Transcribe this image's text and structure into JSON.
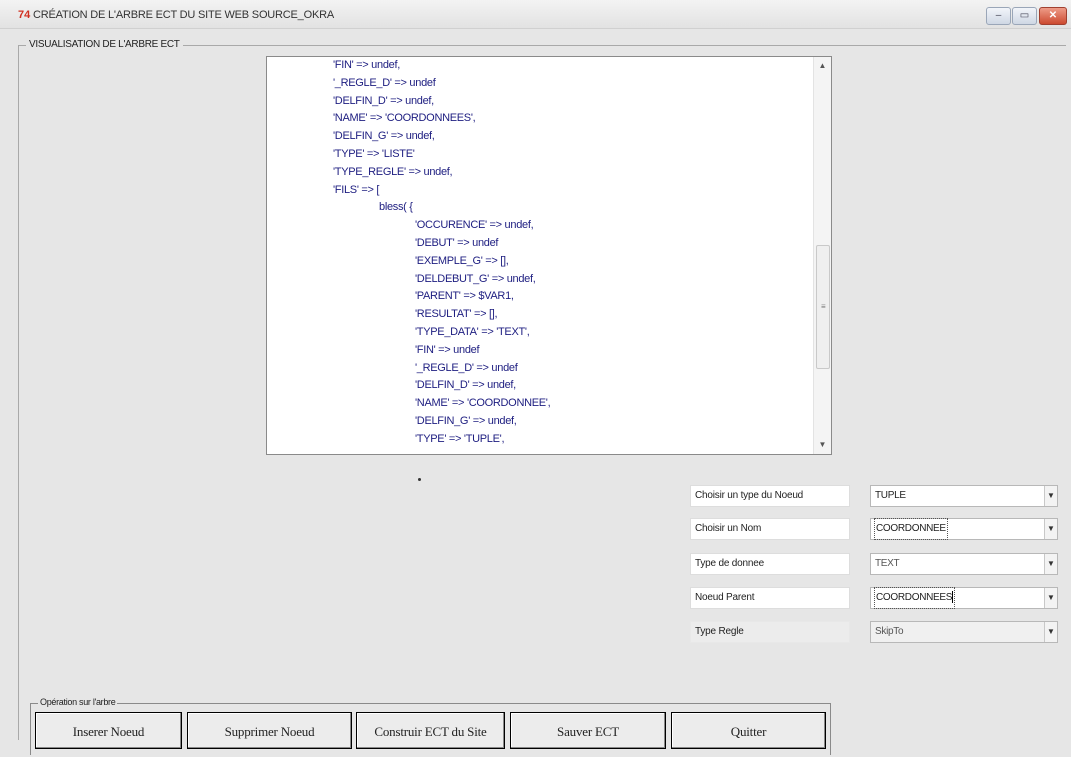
{
  "window": {
    "app_icon": "74",
    "title": "CRÉATION DE L'ARBRE ECT DU SITE WEB SOURCE_OKRA",
    "controls": {
      "minimize": "–",
      "maximize": "▭",
      "close": "✕"
    }
  },
  "tree_group": {
    "label": "VISUALISATION DE L'ARBRE ECT"
  },
  "tree_lines": [
    {
      "indent": 1,
      "text": "'FIN' => undef,"
    },
    {
      "indent": 1,
      "text": "'_REGLE_D' => undef"
    },
    {
      "indent": 1,
      "text": "'DELFIN_D' => undef,"
    },
    {
      "indent": 1,
      "text": "'NAME' => 'COORDONNEES',"
    },
    {
      "indent": 1,
      "text": "'DELFIN_G' => undef,"
    },
    {
      "indent": 1,
      "text": "'TYPE' => 'LISTE'"
    },
    {
      "indent": 1,
      "text": "'TYPE_REGLE' => undef,"
    },
    {
      "indent": 1,
      "text": "'FILS' => ["
    },
    {
      "indent": 2,
      "text": "bless( {"
    },
    {
      "indent": 3,
      "text": "'OCCURENCE' => undef,"
    },
    {
      "indent": 3,
      "text": "'DEBUT' => undef"
    },
    {
      "indent": 3,
      "text": "'EXEMPLE_G' => [],"
    },
    {
      "indent": 3,
      "text": "'DELDEBUT_G' => undef,"
    },
    {
      "indent": 3,
      "text": "'PARENT' => $VAR1,"
    },
    {
      "indent": 3,
      "text": "'RESULTAT' => [],"
    },
    {
      "indent": 3,
      "text": "'TYPE_DATA' => 'TEXT',"
    },
    {
      "indent": 3,
      "text": "'FIN' => undef"
    },
    {
      "indent": 3,
      "text": "'_REGLE_D' => undef"
    },
    {
      "indent": 3,
      "text": "'DELFIN_D' => undef,"
    },
    {
      "indent": 3,
      "text": "'NAME' => 'COORDONNEE',"
    },
    {
      "indent": 3,
      "text": "'DELFIN_G' => undef,"
    },
    {
      "indent": 3,
      "text": "'TYPE' => 'TUPLE',"
    }
  ],
  "tree_scroll": {
    "up": "▲",
    "down": "▼",
    "grip": "≡"
  },
  "form": {
    "node_type": {
      "label": "Choisir un type du Noeud",
      "value": "TUPLE"
    },
    "name": {
      "label": "Choisir un Nom",
      "value": "COORDONNEE"
    },
    "data_type": {
      "label": "Type de donnee",
      "value": "TEXT"
    },
    "parent_node": {
      "label": "Noeud Parent",
      "value": "COORDONNEES"
    },
    "rule_type": {
      "label": "Type Regle",
      "value": "SkipTo"
    },
    "dropdown_glyph": "▼"
  },
  "operations": {
    "label": "Opération sur l'arbre",
    "insert": "Inserer Noeud",
    "delete": "Supprimer Noeud",
    "build": "Construir ECT du Site",
    "save": "Sauver ECT",
    "quit": "Quitter"
  }
}
